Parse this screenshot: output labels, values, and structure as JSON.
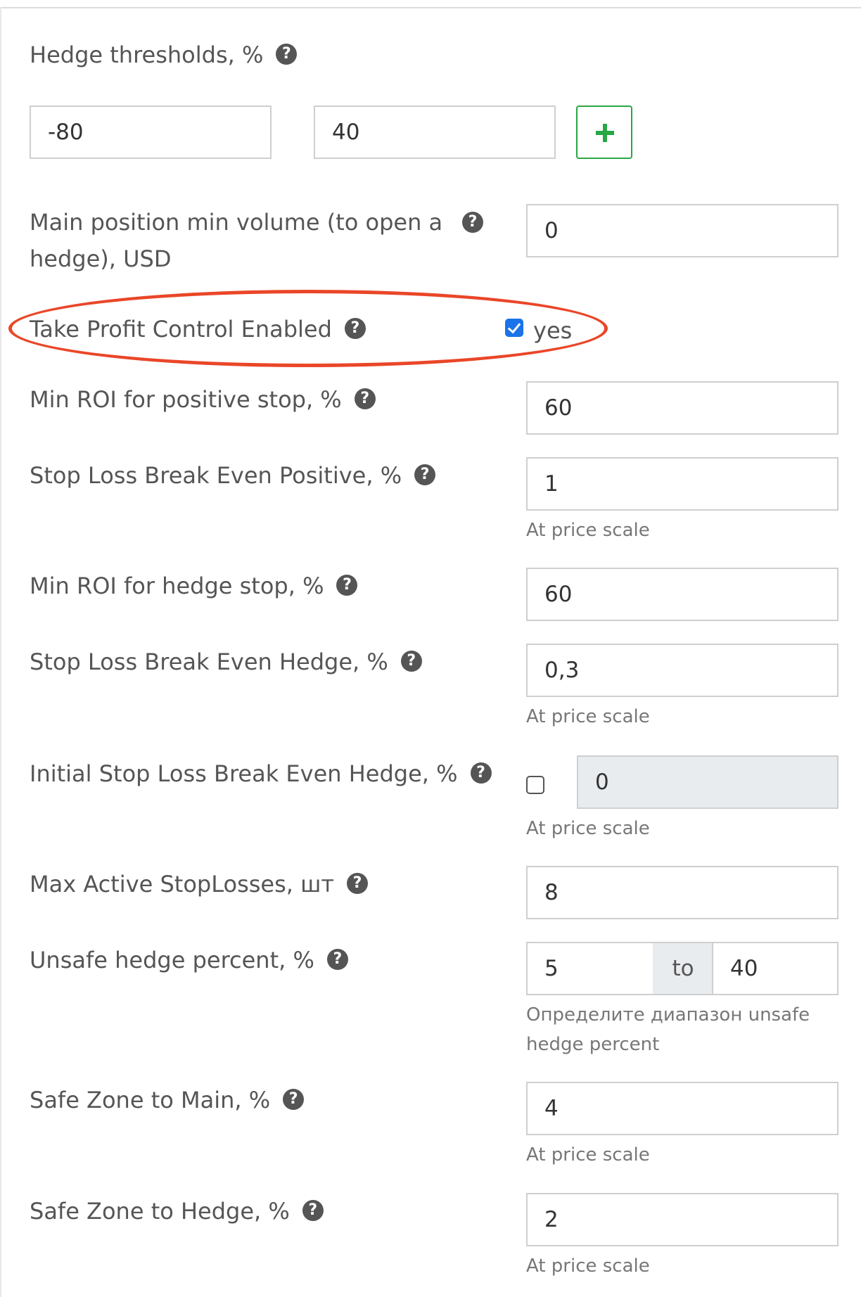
{
  "hedge_thresholds": {
    "label": "Hedge thresholds, %",
    "values": [
      "-80",
      "40"
    ],
    "add_icon": "plus-icon"
  },
  "main_position_min_volume": {
    "label": "Main position min volume (to open a hedge), USD",
    "value": "0"
  },
  "take_profit_control": {
    "label": "Take Profit Control Enabled",
    "checked": true,
    "checkbox_label": "yes",
    "highlight_color": "#ea4628"
  },
  "min_roi_positive_stop": {
    "label": "Min ROI for positive stop, %",
    "value": "60"
  },
  "sl_break_even_positive": {
    "label": "Stop Loss Break Even Positive, %",
    "value": "1",
    "hint": "At price scale"
  },
  "min_roi_hedge_stop": {
    "label": "Min ROI for hedge stop, %",
    "value": "60"
  },
  "sl_break_even_hedge": {
    "label": "Stop Loss Break Even Hedge, %",
    "value": "0,3",
    "hint": "At price scale"
  },
  "initial_sl_break_even_hedge": {
    "label": "Initial Stop Loss Break Even Hedge, %",
    "checked": false,
    "value": "0",
    "hint": "At price scale"
  },
  "max_active_stoplosses": {
    "label": "Max Active StopLosses, шт",
    "value": "8"
  },
  "unsafe_hedge_percent": {
    "label": "Unsafe hedge percent, %",
    "from": "5",
    "to_label": "to",
    "to": "40",
    "hint": "Определите диапазон unsafe hedge percent"
  },
  "safe_zone_main": {
    "label": "Safe Zone to Main, %",
    "value": "4",
    "hint": "At price scale"
  },
  "safe_zone_hedge": {
    "label": "Safe Zone to Hedge, %",
    "value": "2",
    "hint": "At price scale"
  },
  "help_icon": "question-circle-icon",
  "help_glyph": "?",
  "colors": {
    "text": "#555555",
    "border": "#cfcfcf",
    "add_button": "#28a745",
    "checkbox": "#1a73e8",
    "disabled_bg": "#e9ecef"
  }
}
